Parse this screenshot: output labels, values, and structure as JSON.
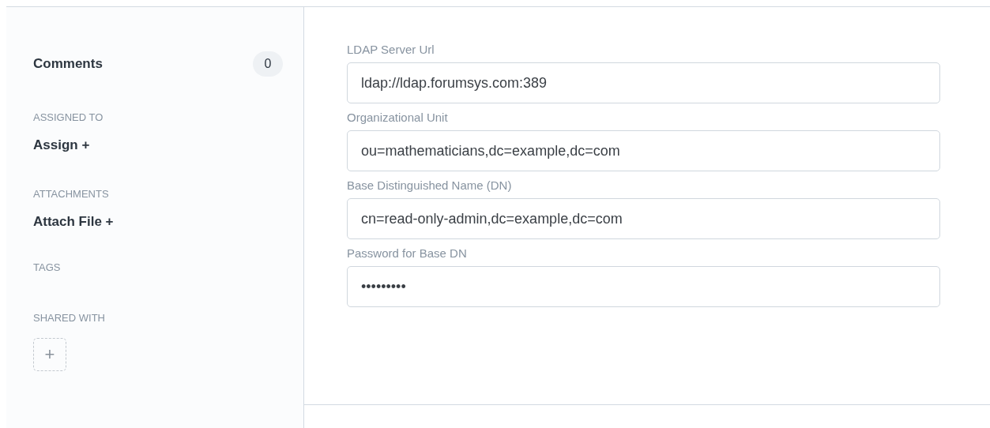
{
  "sidebar": {
    "comments": {
      "label": "Comments",
      "count": "0"
    },
    "sections": [
      {
        "heading": "ASSIGNED TO",
        "kind": "action",
        "action": "Assign +"
      },
      {
        "heading": "ATTACHMENTS",
        "kind": "action",
        "action": "Attach File +"
      },
      {
        "heading": "TAGS",
        "kind": "empty"
      },
      {
        "heading": "SHARED WITH",
        "kind": "add",
        "action": "+"
      }
    ]
  },
  "form": {
    "fields": [
      {
        "label": "LDAP Server Url",
        "value": "ldap://ldap.forumsys.com:389"
      },
      {
        "label": "Organizational Unit",
        "value": "ou=mathematicians,dc=example,dc=com"
      },
      {
        "label": "Base Distinguished Name (DN)",
        "value": "cn=read-only-admin,dc=example,dc=com"
      },
      {
        "label": "Password for Base DN",
        "value": "•••••••••"
      }
    ]
  }
}
